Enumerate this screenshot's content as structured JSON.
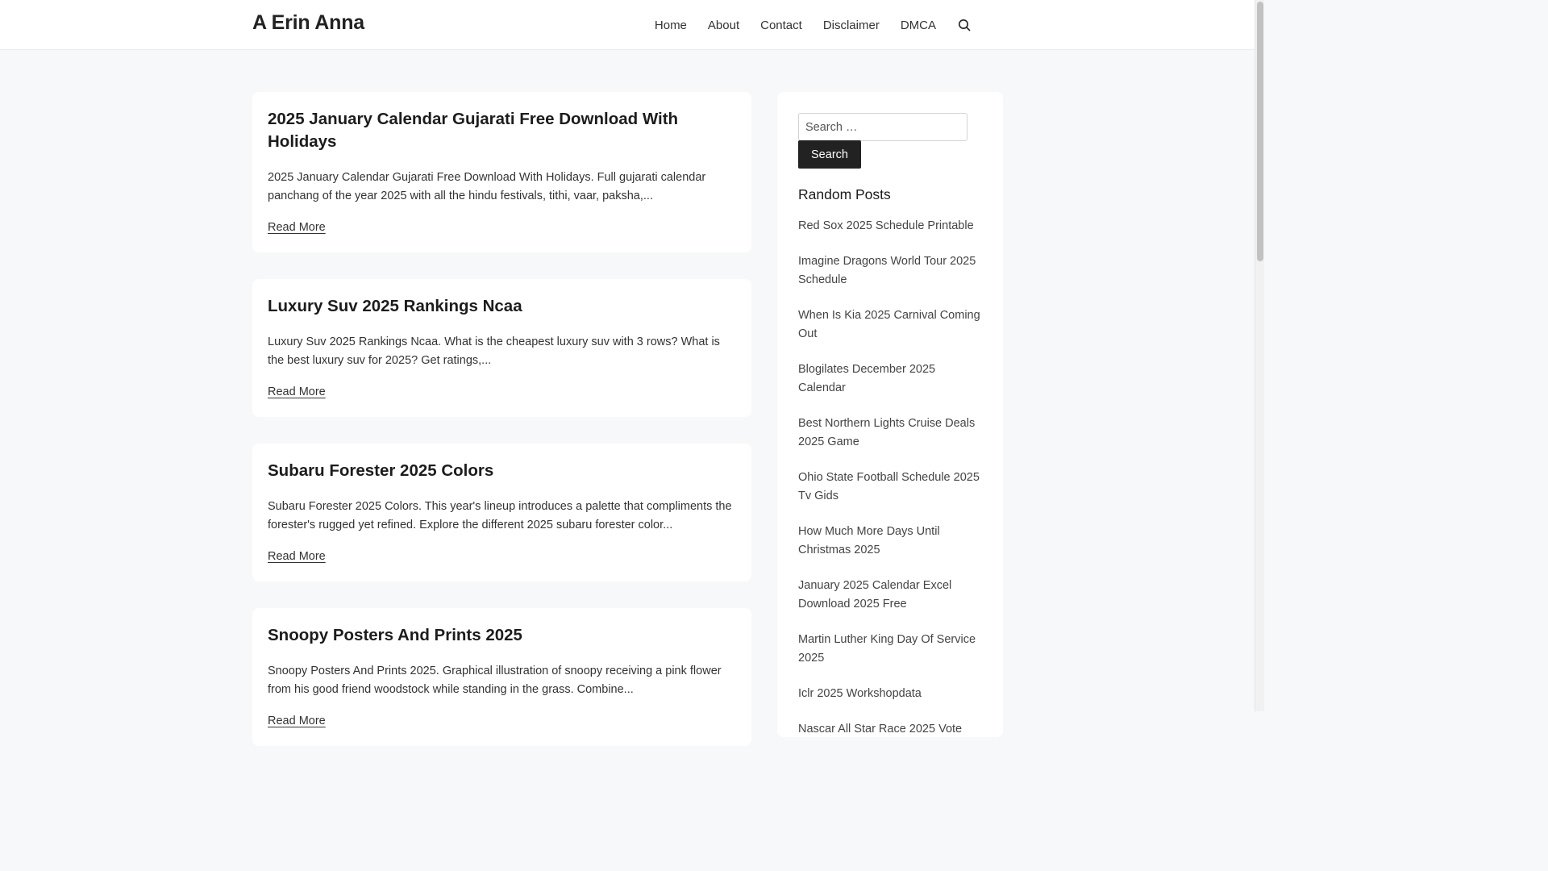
{
  "header": {
    "site_title": "A Erin Anna",
    "nav": [
      "Home",
      "About",
      "Contact",
      "Disclaimer",
      "DMCA"
    ],
    "search_icon": "search-icon"
  },
  "posts": [
    {
      "title": "2025 January Calendar Gujarati Free Download With Holidays",
      "excerpt": "2025 January Calendar Gujarati Free Download With Holidays. Full gujarati calendar panchang of the year 2025 with all the hindu festivals, tithi, vaar, paksha,...",
      "read_more": "Read More"
    },
    {
      "title": "Luxury Suv 2025 Rankings Ncaa",
      "excerpt": "Luxury Suv 2025 Rankings Ncaa. What is the cheapest luxury suv with 3 rows? What is the best luxury suv for 2025? Get ratings,...",
      "read_more": "Read More"
    },
    {
      "title": "Subaru Forester 2025 Colors",
      "excerpt": "Subaru Forester 2025 Colors. This year's lineup introduces a palette that compliments the forester's rugged yet refined. Explore the different 2025 subaru forester color...",
      "read_more": "Read More"
    },
    {
      "title": "Snoopy Posters And Prints 2025",
      "excerpt": "Snoopy Posters And Prints 2025. Graphical illustration of snoopy receiving a pink flower from his good friend woodstock while standing in the grass. Combine...",
      "read_more": "Read More"
    }
  ],
  "sidebar": {
    "search_placeholder": "Search …",
    "search_button": "Search",
    "widget_title": "Random Posts",
    "random_posts": [
      "Red Sox 2025 Schedule Printable",
      "Imagine Dragons World Tour 2025 Schedule",
      "When Is Kia 2025 Carnival Coming Out",
      "Blogilates December 2025 Calendar",
      "Best Northern Lights Cruise Deals 2025 Game",
      "Ohio State Football Schedule 2025 Tv Gids",
      "How Much More Days Until Christmas 2025",
      "January 2025 Calendar Excel Download 2025 Free",
      "Martin Luther King Day Of Service 2025",
      "Iclr 2025 Workshopdata",
      "Nascar All Star Race 2025 Vote"
    ]
  },
  "colors": {
    "page_background": "#f7f8f9",
    "card_background": "#ffffff",
    "button_background": "#222222"
  }
}
